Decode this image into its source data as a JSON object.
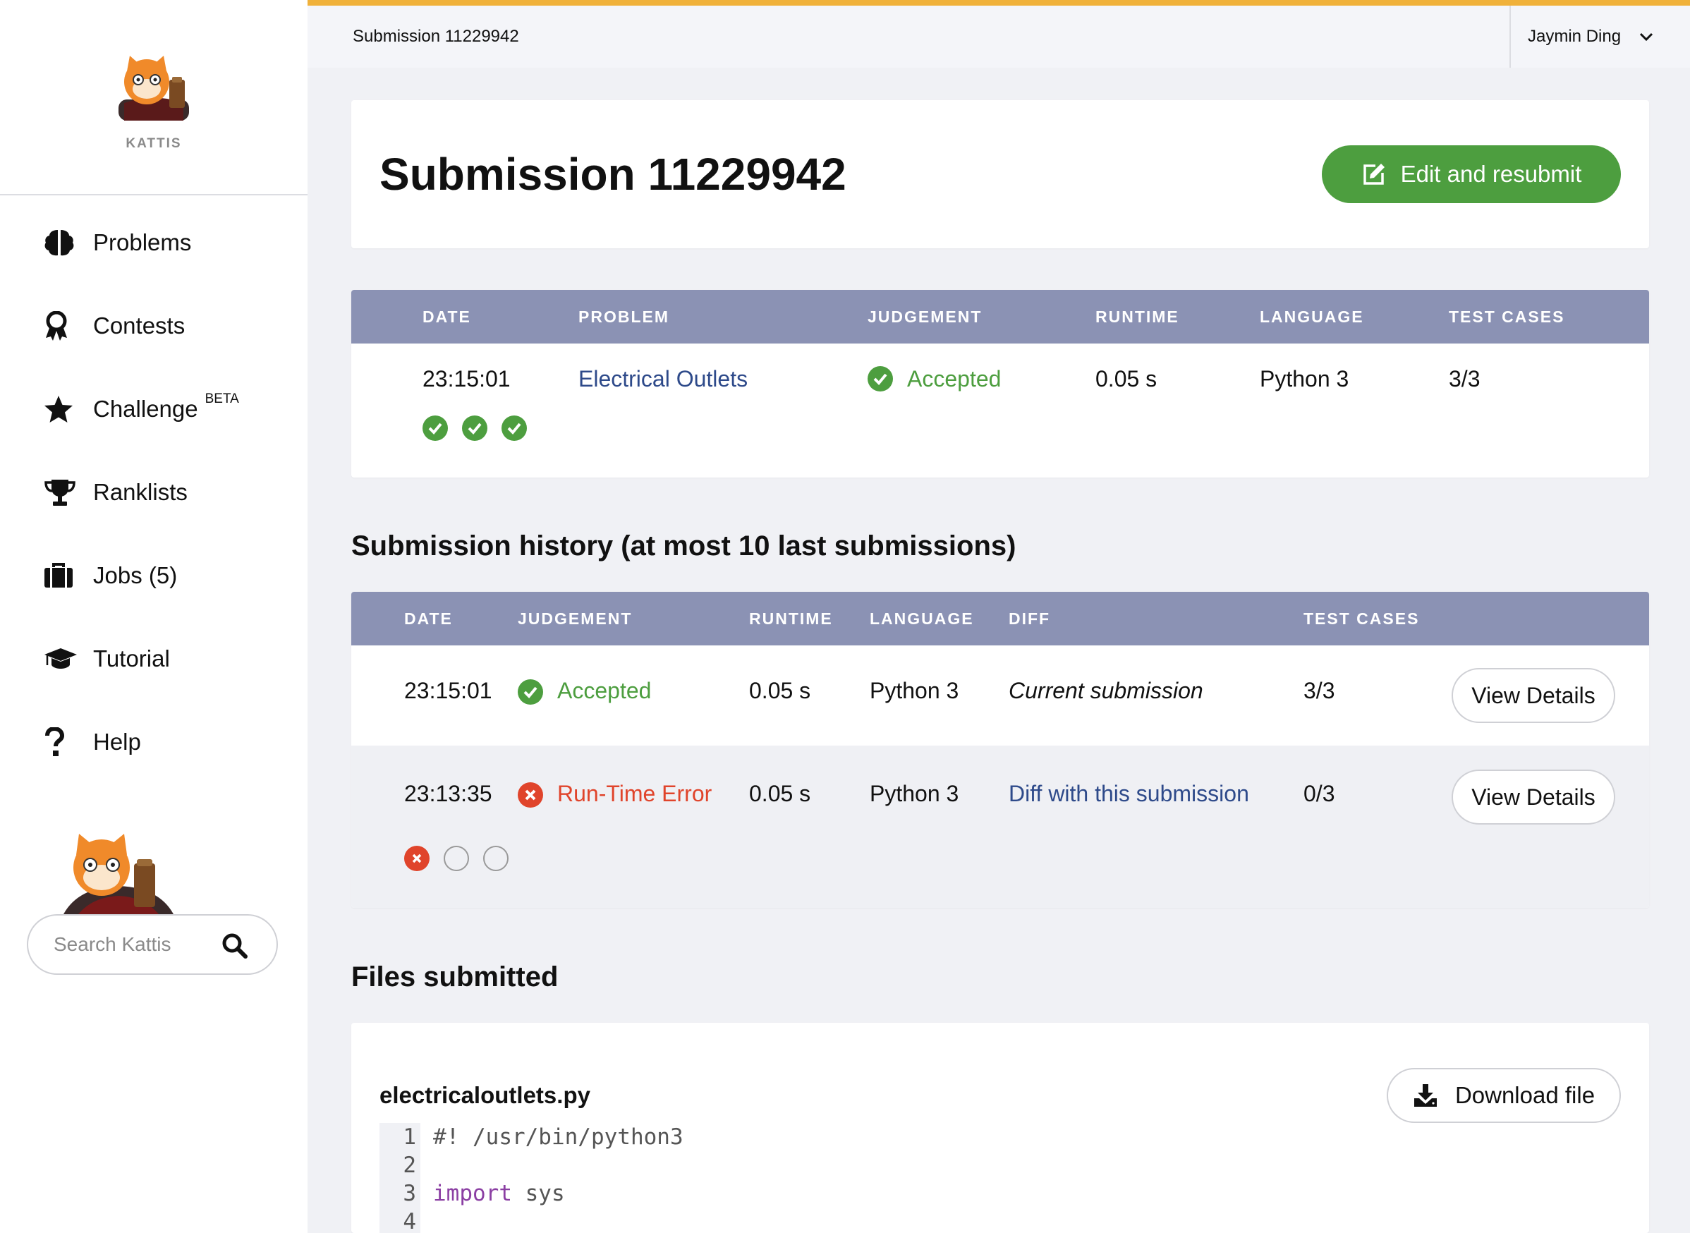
{
  "sidebar": {
    "brand": "KATTIS",
    "nav": [
      {
        "label": "Problems",
        "icon": "brain-icon"
      },
      {
        "label": "Contests",
        "icon": "award-icon"
      },
      {
        "label": "Challenge",
        "icon": "star-icon",
        "badge": "BETA"
      },
      {
        "label": "Ranklists",
        "icon": "trophy-icon"
      },
      {
        "label": "Jobs (5)",
        "icon": "briefcase-icon"
      },
      {
        "label": "Tutorial",
        "icon": "graduation-cap-icon"
      },
      {
        "label": "Help",
        "icon": "question-icon"
      }
    ],
    "search_placeholder": "Search Kattis"
  },
  "topbar": {
    "breadcrumb": "Submission 11229942",
    "user": "Jaymin Ding"
  },
  "title_card": {
    "title": "Submission 11229942",
    "edit_button": "Edit and resubmit"
  },
  "summary": {
    "headers": [
      "DATE",
      "PROBLEM",
      "JUDGEMENT",
      "RUNTIME",
      "LANGUAGE",
      "TEST CASES"
    ],
    "row": {
      "date": "23:15:01",
      "problem": "Electrical Outlets",
      "judgement": "Accepted",
      "runtime": "0.05 s",
      "language": "Python 3",
      "test_cases": "3/3",
      "test_results": [
        "pass",
        "pass",
        "pass"
      ]
    }
  },
  "history": {
    "title": "Submission history (at most 10 last submissions)",
    "headers": [
      "DATE",
      "JUDGEMENT",
      "RUNTIME",
      "LANGUAGE",
      "DIFF",
      "TEST CASES"
    ],
    "rows": [
      {
        "date": "23:15:01",
        "judgement": "Accepted",
        "runtime": "0.05 s",
        "language": "Python 3",
        "diff": "Current submission",
        "test_cases": "3/3",
        "button": "View Details"
      },
      {
        "date": "23:13:35",
        "judgement": "Run-Time Error",
        "runtime": "0.05 s",
        "language": "Python 3",
        "diff": "Diff with this submission",
        "test_cases": "0/3",
        "button": "View Details",
        "test_results": [
          "fail",
          "none",
          "none"
        ]
      }
    ]
  },
  "files": {
    "title": "Files submitted",
    "filename": "electricaloutlets.py",
    "download_button": "Download file",
    "code_lines": [
      {
        "n": "1",
        "text": "#! /usr/bin/python3"
      },
      {
        "n": "2",
        "text": ""
      },
      {
        "n": "3",
        "kw": "import",
        "text": " sys"
      },
      {
        "n": "4",
        "text": ""
      }
    ]
  },
  "colors": {
    "accent_top": "#f0b13a",
    "header_bg": "#8b92b4",
    "success": "#4d9e3f",
    "error": "#e0442b",
    "link": "#2e4a8a"
  }
}
